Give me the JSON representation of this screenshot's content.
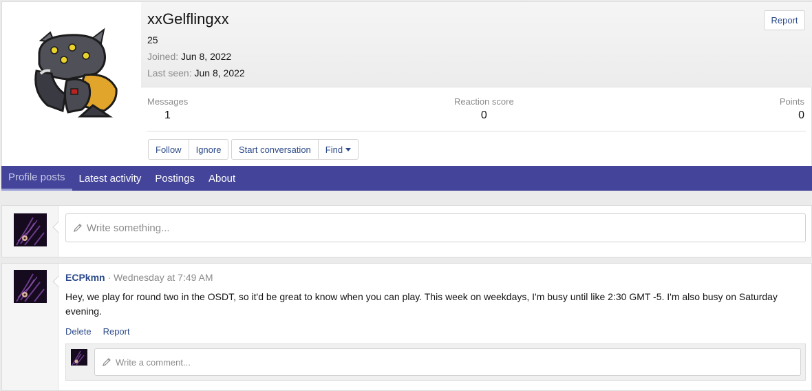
{
  "profile": {
    "username": "xxGelflingxx",
    "title": "25",
    "joined_label": "Joined:",
    "joined_value": "Jun 8, 2022",
    "last_seen_label": "Last seen:",
    "last_seen_value": "Jun 8, 2022",
    "report_label": "Report",
    "avatar_icon": "pokemon-sprite-avatar"
  },
  "stats": {
    "messages_label": "Messages",
    "messages_value": "1",
    "reaction_label": "Reaction score",
    "reaction_value": "0",
    "points_label": "Points",
    "points_value": "0"
  },
  "buttons": {
    "follow": "Follow",
    "ignore": "Ignore",
    "start_conversation": "Start conversation",
    "find": "Find"
  },
  "tabs": [
    {
      "label": "Profile posts",
      "active": true
    },
    {
      "label": "Latest activity",
      "active": false
    },
    {
      "label": "Postings",
      "active": false
    },
    {
      "label": "About",
      "active": false
    }
  ],
  "composer": {
    "placeholder": "Write something..."
  },
  "post": {
    "author": "ECPkmn",
    "separator": " · ",
    "time": "Wednesday at 7:49 AM",
    "body": "Hey, we play for round two in the OSDT, so it'd be great to know when you can play. This week on weekdays, I'm busy until like 2:30 GMT -5. I'm also busy on Saturday evening.",
    "delete_label": "Delete",
    "report_label": "Report",
    "comment_placeholder": "Write a comment..."
  },
  "colors": {
    "nav_bar": "#44449a",
    "link": "#2c4a8a",
    "active_tab_text": "#c8cbe8"
  }
}
